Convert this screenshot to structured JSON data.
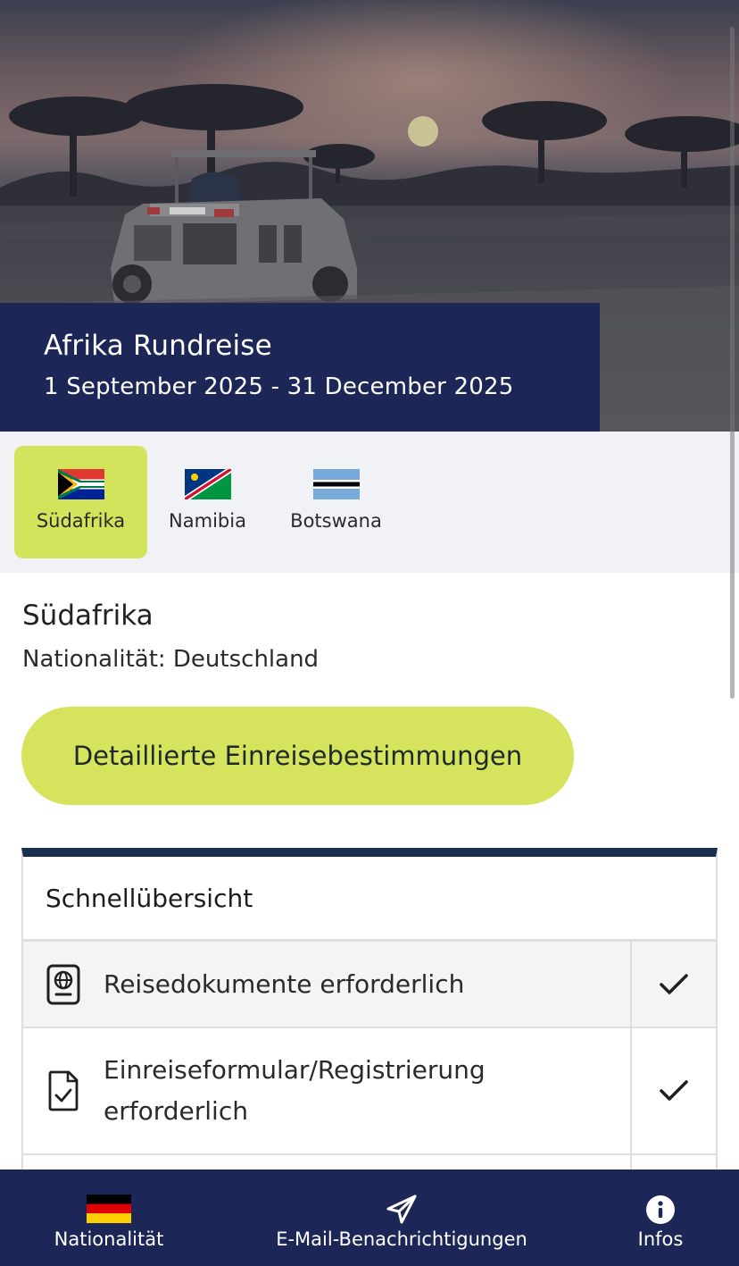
{
  "hero": {
    "image_description_icon": "safari-landscape-image",
    "trip_title": "Afrika Rundreise",
    "trip_dates": "1 September 2025 - 31 December 2025"
  },
  "tabs": [
    {
      "label": "Südafrika",
      "flag": "south-africa-flag",
      "active": true
    },
    {
      "label": "Namibia",
      "flag": "namibia-flag",
      "active": false
    },
    {
      "label": "Botswana",
      "flag": "botswana-flag",
      "active": false
    }
  ],
  "content": {
    "country": "Südafrika",
    "nationality": "Nationalität: Deutschland",
    "detail_button": "Detaillierte Einreisebestimmungen"
  },
  "overview": {
    "title": "Schnellübersicht",
    "rows": [
      {
        "label": "Reisedokumente erforderlich",
        "icon": "passport-icon",
        "status": "check-icon"
      },
      {
        "label": "Einreiseformular/Registrierung erforderlich",
        "icon": "document-check-icon",
        "status": "check-icon"
      }
    ]
  },
  "bottom_nav": {
    "nationality": {
      "label": "Nationalität",
      "icon": "germany-flag"
    },
    "email": {
      "label": "E-Mail-Benachrichtigungen",
      "icon": "paper-plane-icon"
    },
    "info": {
      "label": "Infos",
      "icon": "info-icon"
    }
  },
  "colors": {
    "navy": "#1d2757",
    "accent_green": "#d5e35d",
    "card_border_top": "#17304f",
    "tab_bg": "#f1f2f5"
  }
}
